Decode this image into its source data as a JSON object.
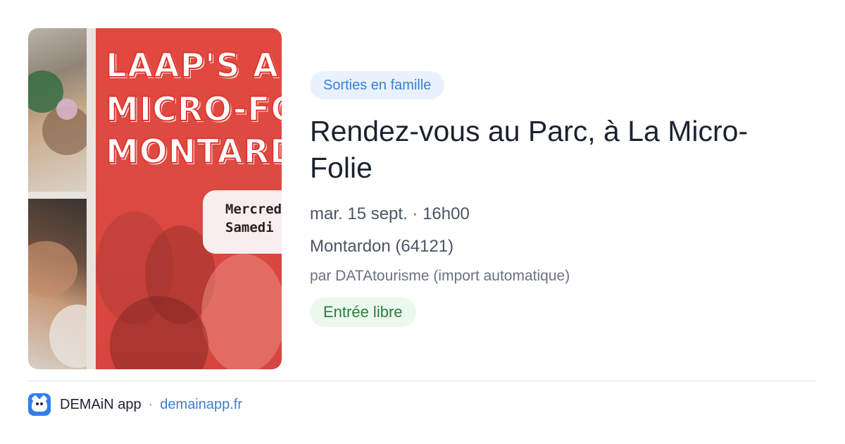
{
  "image": {
    "poster_lines": [
      "LAAP'S ART",
      "MICRO-FOL",
      "MONTARDO"
    ],
    "poster_band_lines": [
      "Mercred",
      "Samedi S"
    ]
  },
  "event": {
    "category": "Sorties en famille",
    "title": "Rendez-vous au Parc, à La Micro-Folie",
    "date": "mar. 15 sept. · 16h00",
    "location": "Montardon (64121)",
    "source": "par DATAtourisme (import automatique)",
    "price": "Entrée libre"
  },
  "footer": {
    "app_name": "DEMAiN app",
    "separator": "·",
    "url": "demainapp.fr",
    "logo_icon": "cat-logo-icon"
  },
  "colors": {
    "accent": "#3b7ed2",
    "tag_bg": "#e9f2fc",
    "price_text": "#2d7d3e",
    "price_bg": "#ebf8ee",
    "poster_red": "#e2493f"
  }
}
